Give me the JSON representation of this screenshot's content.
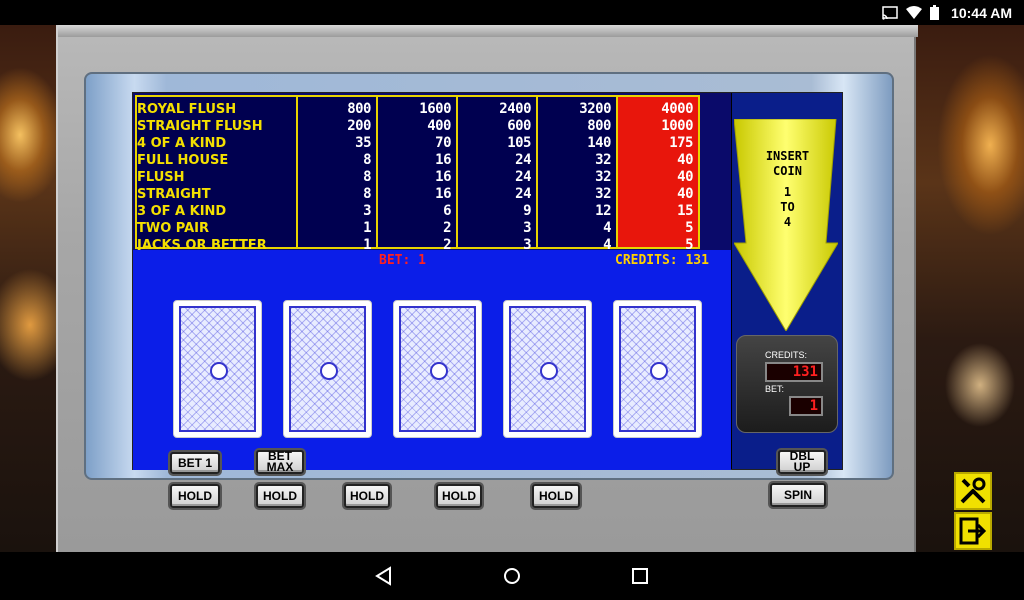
{
  "status_bar": {
    "time": "10:44 AM",
    "icons": [
      "cast-icon",
      "wifi-icon",
      "battery-icon"
    ]
  },
  "pay_table": {
    "hands": [
      "ROYAL FLUSH",
      "STRAIGHT FLUSH",
      "4 OF A KIND",
      "FULL HOUSE",
      "FLUSH",
      "STRAIGHT",
      "3 OF A KIND",
      "TWO PAIR",
      "JACKS OR BETTER"
    ],
    "columns": [
      [
        "800",
        "200",
        "35",
        "8",
        "8",
        "8",
        "3",
        "1",
        "1"
      ],
      [
        "1600",
        "400",
        "70",
        "16",
        "16",
        "16",
        "6",
        "2",
        "2"
      ],
      [
        "2400",
        "600",
        "105",
        "24",
        "24",
        "24",
        "9",
        "3",
        "3"
      ],
      [
        "3200",
        "800",
        "140",
        "32",
        "32",
        "32",
        "12",
        "4",
        "4"
      ],
      [
        "4000",
        "1000",
        "175",
        "40",
        "40",
        "40",
        "15",
        "5",
        "5"
      ]
    ],
    "highlight_color": "#e8160c",
    "border_color": "#e8d400"
  },
  "game": {
    "bet_text": "BET: 1",
    "credits_text": "CREDITS: 131",
    "cards": [
      "card-back",
      "card-back",
      "card-back",
      "card-back",
      "card-back"
    ]
  },
  "insert_coin": {
    "line1": "INSERT",
    "line2": "COIN",
    "line3": "1",
    "line4": "TO",
    "line5": "4"
  },
  "counter": {
    "credits_label": "CREDITS:",
    "credits_value": "131",
    "bet_label": "BET:",
    "bet_value": "1"
  },
  "buttons": {
    "bet1": "BET 1",
    "bet_max_line1": "BET",
    "bet_max_line2": "MAX",
    "hold": "HOLD",
    "dbl_up": "DBL UP",
    "spin": "SPIN"
  },
  "colors": {
    "screen_bg": "#0a0a6a",
    "game_bg": "#0b1ee8",
    "accent_yellow": "#f0e000"
  }
}
